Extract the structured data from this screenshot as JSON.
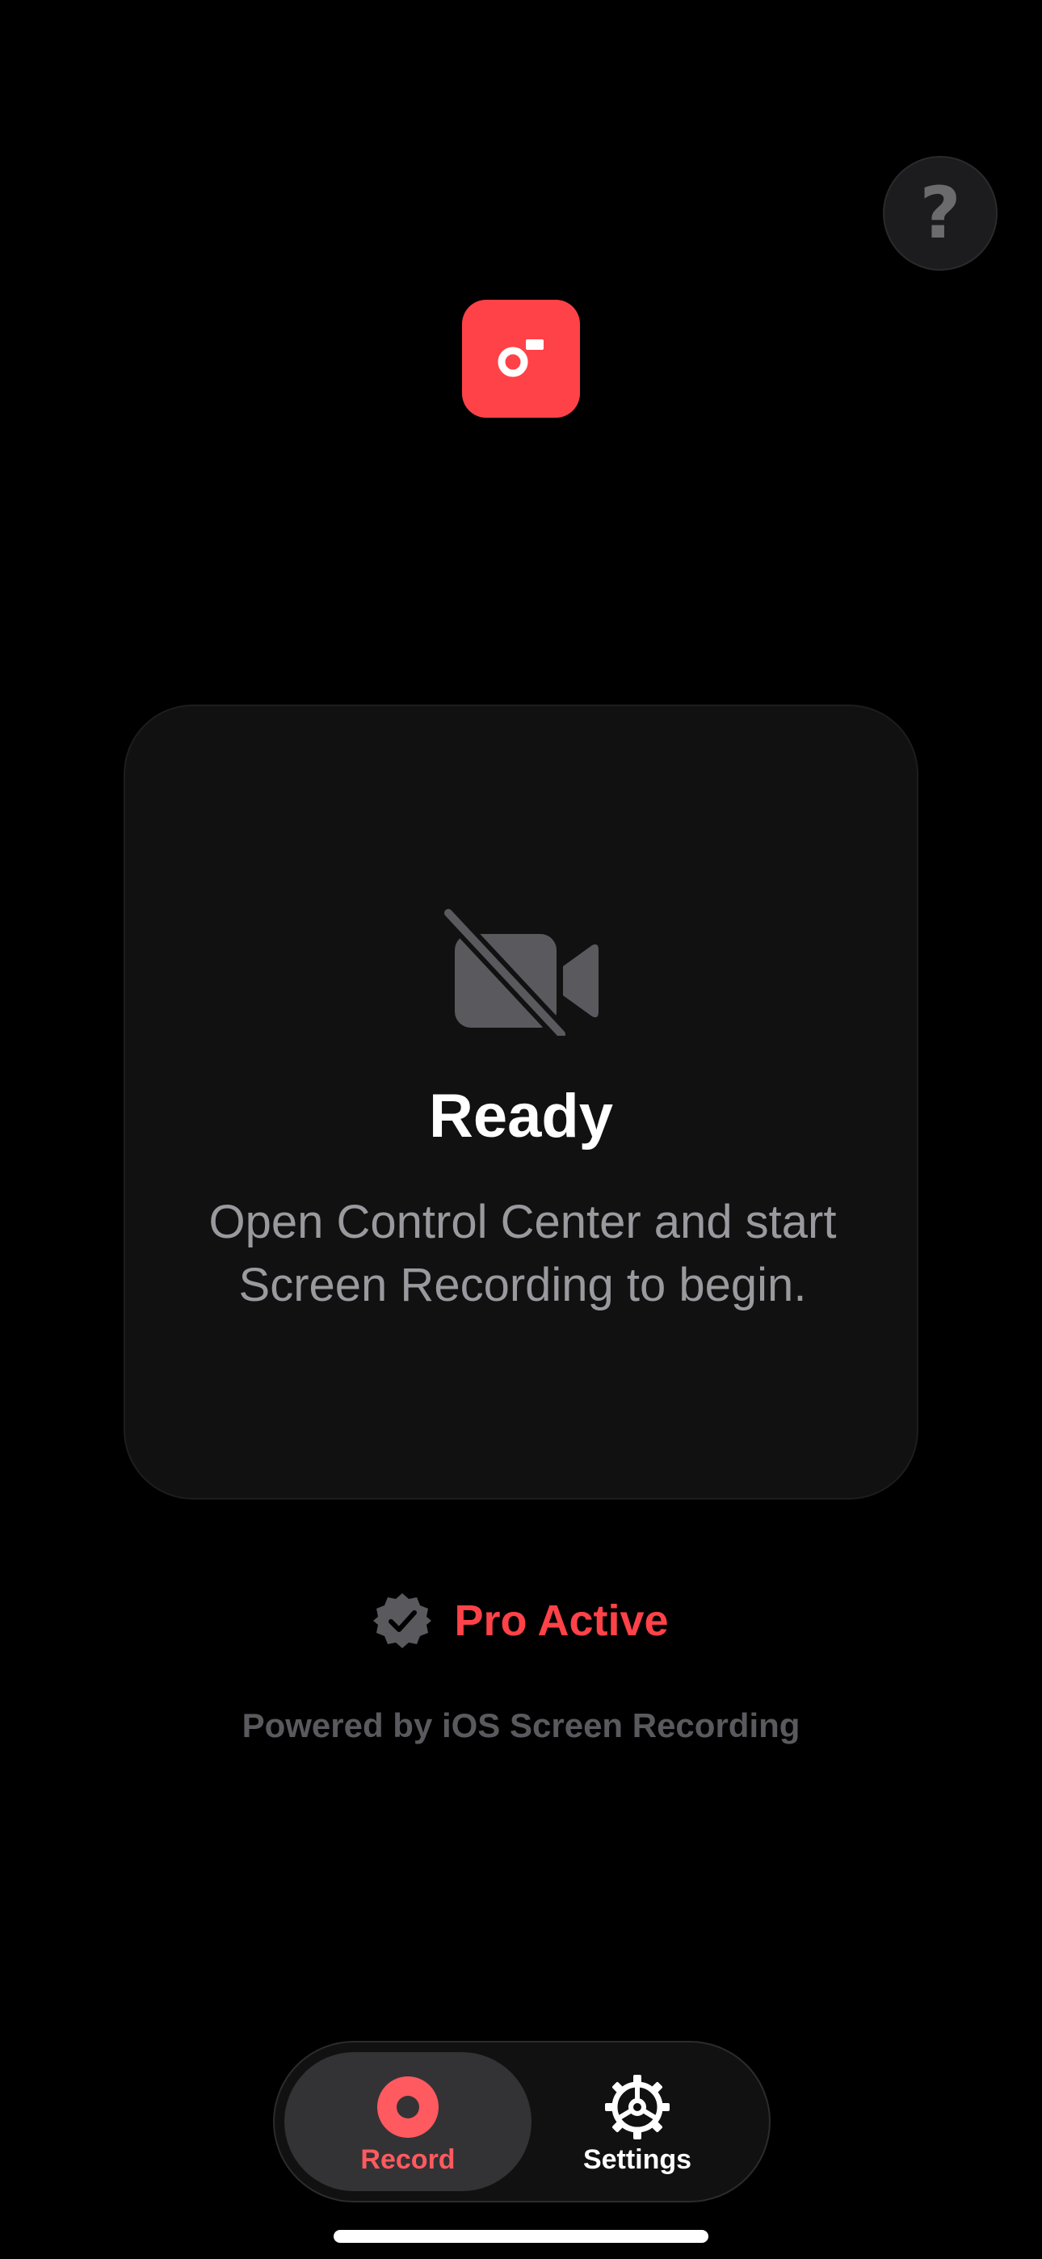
{
  "help": {
    "glyph": "?",
    "icon": "question-mark-icon"
  },
  "app": {
    "icon": "screen-record-logo-icon",
    "brand_color": "#ff4248"
  },
  "status": {
    "icon": "video-camera-off-icon",
    "title": "Ready",
    "message": "Open Control Center and start Screen Recording to begin."
  },
  "pro": {
    "icon": "verified-badge-icon",
    "label": "Pro Active",
    "color": "#ff4248"
  },
  "footer": {
    "powered_by": "Powered by iOS Screen Recording"
  },
  "tabs": [
    {
      "id": "record",
      "label": "Record",
      "icon": "record-icon",
      "selected": true
    },
    {
      "id": "settings",
      "label": "Settings",
      "icon": "gear-icon",
      "selected": false
    }
  ]
}
